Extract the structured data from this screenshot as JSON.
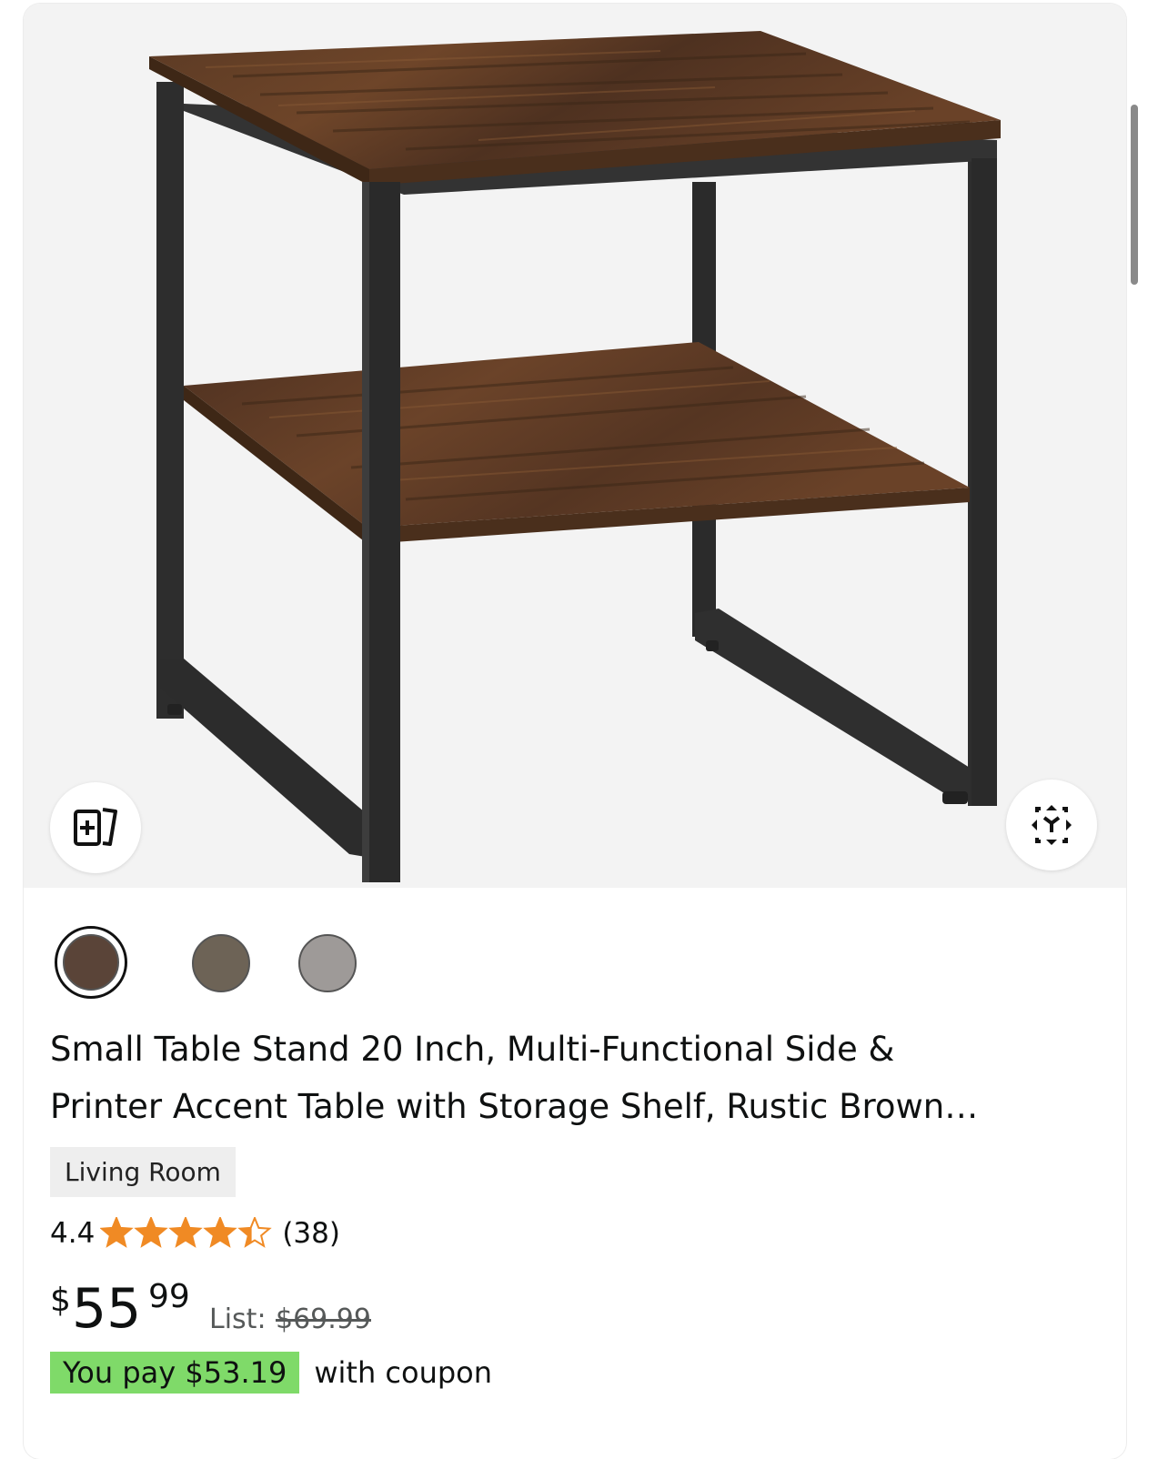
{
  "product": {
    "title_line1": "Small Table Stand 20 Inch, Multi-Functional Side &",
    "title_line2": "Printer Accent Table with Storage Shelf, Rustic Brown…",
    "category": "Living Room",
    "rating": {
      "value_text": "4.4",
      "value": 4.4,
      "max": 5,
      "review_count": "(38)"
    },
    "price": {
      "symbol": "$",
      "whole": "55",
      "fraction": "99",
      "list_label": "List:",
      "list_price": "$69.99"
    },
    "coupon": {
      "badge": "You pay $53.19",
      "text": "with coupon"
    },
    "swatches": [
      {
        "color": "#5a4438",
        "selected": true
      },
      {
        "color": "#6d6356",
        "selected": false
      },
      {
        "color": "#9e9a98",
        "selected": false
      }
    ]
  },
  "colors": {
    "star": "#f08a24",
    "coupon_badge": "#7fda69",
    "media_bg": "#f3f3f3"
  },
  "icons": {
    "compare": "compare-cards-icon",
    "ar_view": "view-in-3d-icon"
  }
}
